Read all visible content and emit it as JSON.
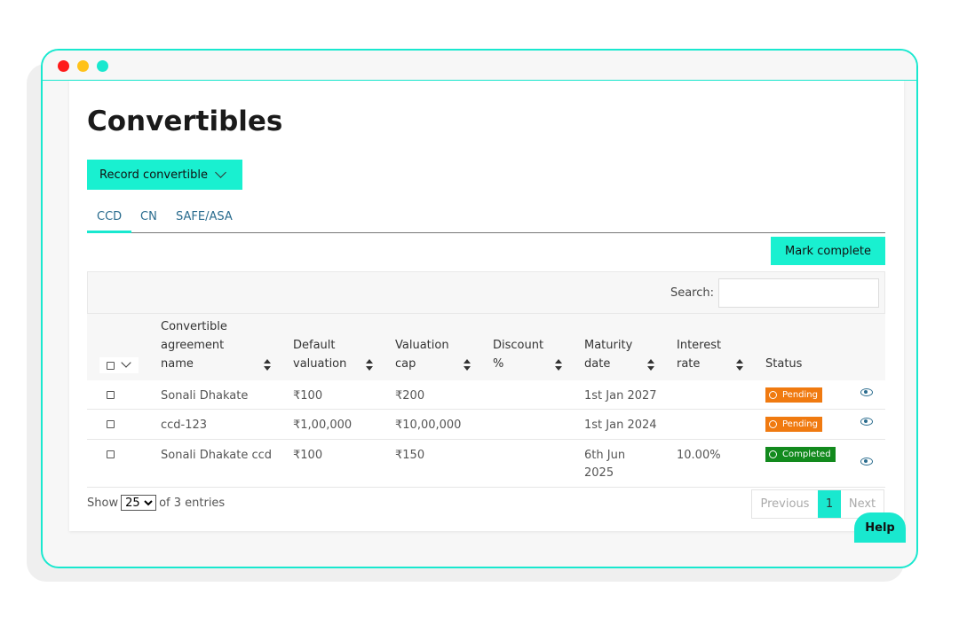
{
  "page": {
    "title": "Convertibles",
    "record_button": "Record convertible",
    "mark_complete_button": "Mark complete",
    "help_button": "Help"
  },
  "tabs": [
    {
      "label": "CCD",
      "active": true
    },
    {
      "label": "CN",
      "active": false
    },
    {
      "label": "SAFE/ASA",
      "active": false
    }
  ],
  "search": {
    "label": "Search:",
    "placeholder": ""
  },
  "table": {
    "columns": [
      "Convertible agreement name",
      "Default valuation",
      "Valuation cap",
      "Discount %",
      "Maturity date",
      "Interest rate",
      "Status"
    ],
    "rows": [
      {
        "name": "Sonali Dhakate",
        "default_valuation": "₹100",
        "valuation_cap": "₹200",
        "discount": "",
        "maturity_date": "1st Jan 2027",
        "interest_rate": "",
        "status": "Pending"
      },
      {
        "name": "ccd-123",
        "default_valuation": "₹1,00,000",
        "valuation_cap": "₹10,00,000",
        "discount": "",
        "maturity_date": "1st Jan 2024",
        "interest_rate": "",
        "status": "Pending"
      },
      {
        "name": "Sonali Dhakate ccd",
        "default_valuation": "₹100",
        "valuation_cap": "₹150",
        "discount": "",
        "maturity_date": "6th Jun 2025",
        "interest_rate": "10.00%",
        "status": "Completed"
      }
    ]
  },
  "footer": {
    "show_label": "Show",
    "page_size": "25",
    "entries_label": "of 3 entries",
    "previous": "Previous",
    "current_page": "1",
    "next": "Next"
  },
  "colors": {
    "accent": "#19e8cf",
    "pending": "#f07a10",
    "completed": "#128a1d",
    "link": "#2a6c8e",
    "dot_red": "#ff1a1a",
    "dot_yellow": "#ffc21a",
    "dot_green": "#19e8cf"
  },
  "icons": {
    "pending_icon": "clock-icon",
    "completed_icon": "check-circle-icon",
    "view_icon": "eye-icon"
  }
}
